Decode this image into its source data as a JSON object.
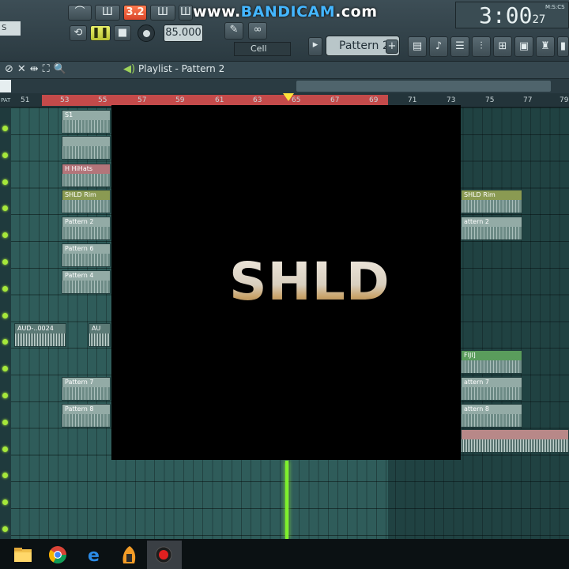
{
  "toolbar": {
    "watermark_prefix": "www.",
    "watermark_brand": "BANDICAM",
    "watermark_suffix": ".com",
    "snap_value": "3.2",
    "tempo": "85.000",
    "time_main": "3:00",
    "time_sub": "27",
    "time_unit": "M:S:CS",
    "pattern": "Pattern 2",
    "cell_mode": "Cell",
    "left_stub": "S"
  },
  "playlist": {
    "title": "Playlist - Pattern 2",
    "pat_label": "PAT",
    "bars": [
      "51",
      "53",
      "55",
      "57",
      "59",
      "61",
      "63",
      "65",
      "67",
      "69",
      "71",
      "73",
      "75",
      "77",
      "79"
    ]
  },
  "clips": [
    {
      "name": "S1",
      "kind": "pattern"
    },
    {
      "name": "",
      "kind": "pattern"
    },
    {
      "name": "H HiHats",
      "kind": "red"
    },
    {
      "name": "SHLD Rim",
      "kind": "olive"
    },
    {
      "name": "Pattern 2",
      "kind": "pattern"
    },
    {
      "name": "Pattern 6",
      "kind": "pattern"
    },
    {
      "name": "Pattern 4",
      "kind": "pattern"
    },
    {
      "name": "AUD-..0024",
      "kind": "audio"
    },
    {
      "name": "AU",
      "kind": "audio"
    },
    {
      "name": "Pattern 7",
      "kind": "pattern"
    },
    {
      "name": "Pattern 8",
      "kind": "pattern"
    },
    {
      "name": "SHLD Rim",
      "kind": "olive"
    },
    {
      "name": "attern 2",
      "kind": "pattern"
    },
    {
      "name": "FIJI]",
      "kind": "green"
    },
    {
      "name": "attern 7",
      "kind": "pattern"
    },
    {
      "name": "attern 8",
      "kind": "pattern"
    }
  ],
  "overlay": {
    "logo_text": "SHLD"
  },
  "taskbar": {
    "apps": [
      "folder-icon",
      "chrome-icon",
      "edge-icon",
      "fl-studio-icon",
      "bandicam-record-icon"
    ]
  },
  "colors": {
    "accent": "#ff7b4f",
    "playhead": "#7ff02c",
    "ruler_selection": "#c44a4a",
    "led": "#a6e83b"
  }
}
